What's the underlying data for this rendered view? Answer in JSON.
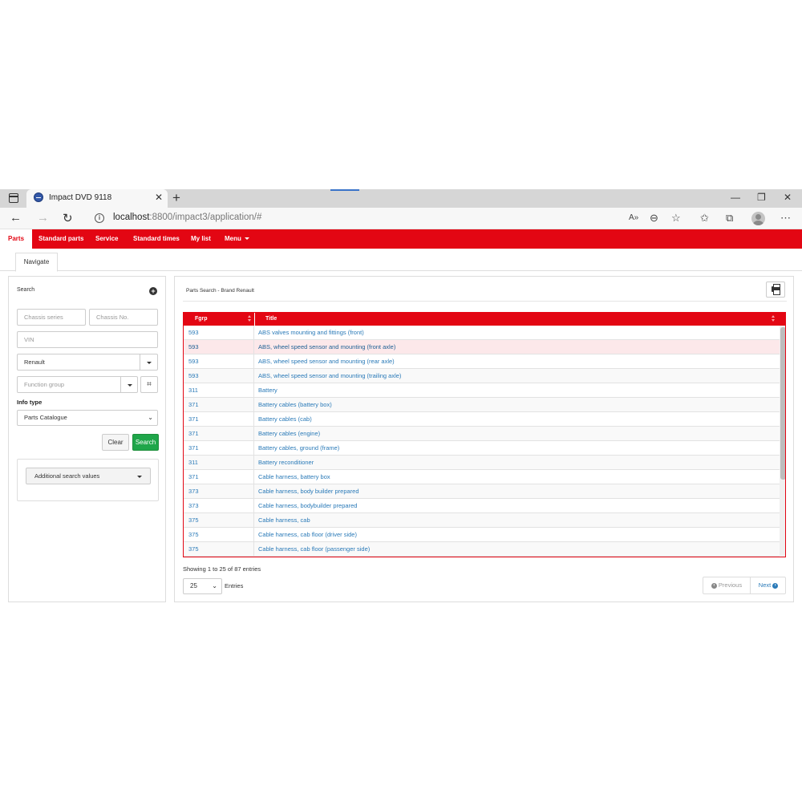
{
  "browser": {
    "tab_title": "Impact DVD 9118",
    "url_host": "localhost",
    "url_rest": ":8800/impact3/application/#"
  },
  "icons": {
    "window_menu": "window-icon",
    "favicon": "globe-icon",
    "close_tab": "close-icon",
    "new_tab": "plus-icon",
    "back": "arrow-left-icon",
    "forward": "arrow-right-icon",
    "refresh": "refresh-icon",
    "info": "info-icon",
    "read_aloud": "read-aloud-icon",
    "zoom": "zoom-icon",
    "favorite_add": "star-plus-icon",
    "favorites": "favorites-icon",
    "collections": "collections-icon",
    "profile": "avatar-icon",
    "more": "ellipsis-icon"
  },
  "glyphs": {
    "close": "✕",
    "plus": "+",
    "minimize": "—",
    "restore": "❐",
    "back": "←",
    "forward": "→",
    "refresh": "↻",
    "info": "i",
    "read_aloud": "A»",
    "zoom": "⊖",
    "fav_add": "☆",
    "favorites": "✩",
    "collections": "⧉",
    "more": "⋯",
    "chevron": "⌄",
    "scan": "⌗",
    "add_circle": "+",
    "prev_circle": "‹",
    "next_circle": "›"
  },
  "nav": {
    "items": [
      "Parts",
      "Standard parts",
      "Service",
      "Standard times",
      "My list",
      "Menu"
    ],
    "active": "Parts"
  },
  "subtab": "Navigate",
  "search": {
    "title": "Search",
    "chassis_series_placeholder": "Chassis series",
    "chassis_no_placeholder": "Chassis No.",
    "vin_placeholder": "VIN",
    "brand_value": "Renault",
    "function_group_placeholder": "Function group",
    "info_type_label": "Info type",
    "info_type_value": "Parts Catalogue",
    "clear_label": "Clear",
    "search_label": "Search",
    "additional_label": "Additional search values"
  },
  "results": {
    "title": "Parts Search - Brand Renault",
    "columns": [
      "Fgrp",
      "Title"
    ],
    "rows": [
      {
        "fgrp": "593",
        "title": "ABS valves mounting and fittings (front)"
      },
      {
        "fgrp": "593",
        "title": "ABS, wheel speed sensor and mounting (front axle)",
        "highlight": true
      },
      {
        "fgrp": "593",
        "title": "ABS, wheel speed sensor and mounting (rear axle)"
      },
      {
        "fgrp": "593",
        "title": "ABS, wheel speed sensor and mounting (trailing axle)"
      },
      {
        "fgrp": "311",
        "title": "Battery"
      },
      {
        "fgrp": "371",
        "title": "Battery cables (battery box)"
      },
      {
        "fgrp": "371",
        "title": "Battery cables (cab)"
      },
      {
        "fgrp": "371",
        "title": "Battery cables (engine)"
      },
      {
        "fgrp": "371",
        "title": "Battery cables, ground (frame)"
      },
      {
        "fgrp": "311",
        "title": "Battery reconditioner"
      },
      {
        "fgrp": "371",
        "title": "Cable harness, battery box"
      },
      {
        "fgrp": "373",
        "title": "Cable harness, body builder prepared"
      },
      {
        "fgrp": "373",
        "title": "Cable harness, bodybuilder prepared"
      },
      {
        "fgrp": "375",
        "title": "Cable harness, cab"
      },
      {
        "fgrp": "375",
        "title": "Cable harness, cab floor (driver side)"
      },
      {
        "fgrp": "375",
        "title": "Cable harness, cab floor (passenger side)"
      }
    ],
    "info": "Showing 1 to 25 of 87 entries",
    "page_length": "25",
    "entries_label": "Entries",
    "prev_label": "Previous",
    "next_label": "Next"
  },
  "colors": {
    "brand_red": "#e30613",
    "link_blue": "#2a7ab8",
    "search_green": "#1fa64a"
  }
}
